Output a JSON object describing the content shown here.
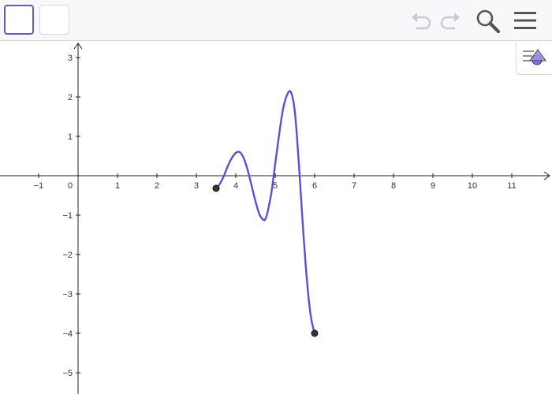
{
  "toolbar": {
    "tools": [
      {
        "name": "tool-move",
        "active": true
      },
      {
        "name": "tool-empty",
        "active": false
      }
    ],
    "icons": [
      "undo-icon",
      "redo-icon",
      "search-icon",
      "menu-icon"
    ]
  },
  "style_bar": {
    "icon": "style-bar-icon"
  },
  "colors": {
    "curve": "#5a4fe0",
    "accent": "#6557d2",
    "point": "#333333",
    "axis": "#222222"
  },
  "axes": {
    "x_ticks": [
      "−1",
      "0",
      "1",
      "2",
      "3",
      "4",
      "5",
      "6",
      "7",
      "8",
      "9",
      "10",
      "11"
    ],
    "y_ticks": [
      "3",
      "2",
      "1",
      "−1",
      "−2",
      "−3",
      "−4",
      "−5"
    ]
  },
  "chart_data": {
    "type": "line",
    "xlim": [
      -2,
      12
    ],
    "ylim": [
      -5.5,
      3.3
    ],
    "grid": false,
    "series": [
      {
        "x": [
          3.5,
          3.6,
          3.7,
          3.8,
          3.9,
          4.0,
          4.1,
          4.2,
          4.3,
          4.4,
          4.5,
          4.6,
          4.7,
          4.75,
          4.8,
          4.9,
          5.0,
          5.1,
          5.2,
          5.3,
          5.4,
          5.5,
          5.6,
          5.7,
          5.8,
          5.9,
          6.0
        ],
        "y": [
          -0.32,
          -0.2,
          0.0,
          0.25,
          0.45,
          0.58,
          0.6,
          0.45,
          0.15,
          -0.25,
          -0.65,
          -0.98,
          -1.12,
          -1.1,
          -0.95,
          -0.45,
          0.3,
          1.05,
          1.7,
          2.05,
          2.12,
          1.6,
          0.3,
          -1.25,
          -2.6,
          -3.55,
          -4.0
        ]
      }
    ],
    "points": [
      {
        "x": 3.5,
        "y": -0.32
      },
      {
        "x": 6.0,
        "y": -4.0
      }
    ]
  }
}
